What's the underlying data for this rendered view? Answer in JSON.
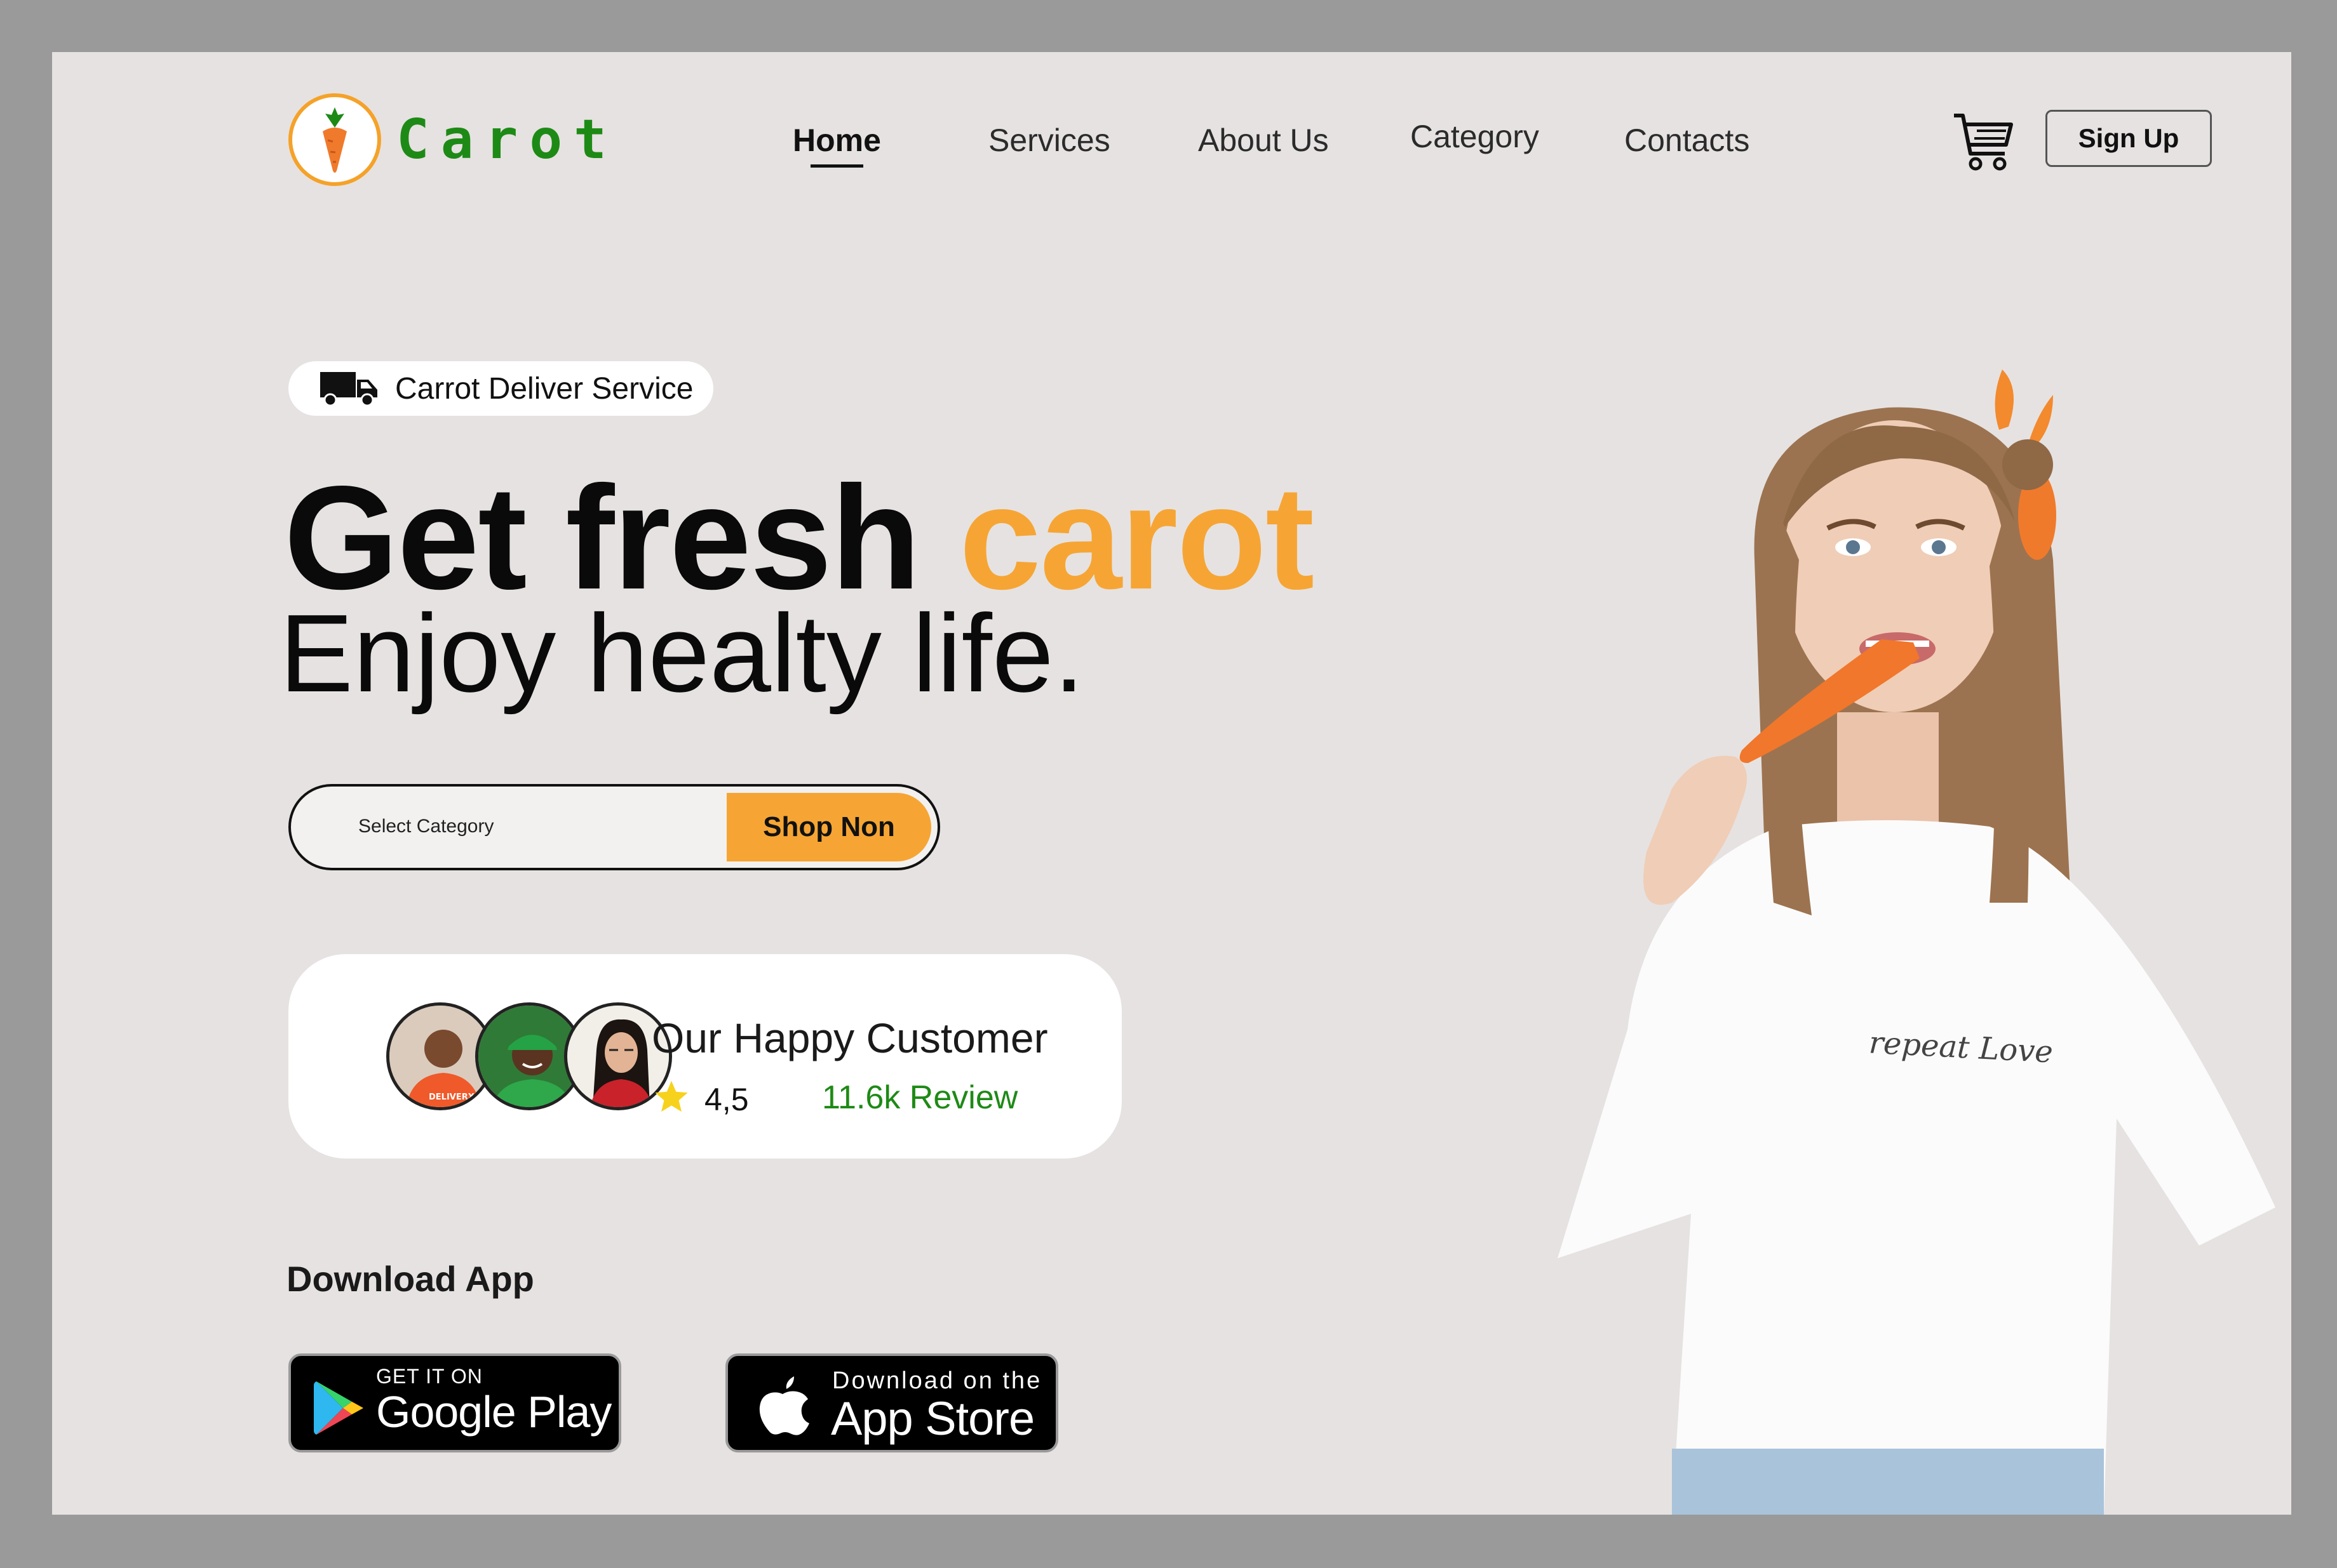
{
  "brand": {
    "name": "Carot",
    "icon": "carrot-icon",
    "color": "#1e8a16"
  },
  "nav": {
    "items": [
      {
        "label": "Home",
        "active": true
      },
      {
        "label": "Services",
        "active": false
      },
      {
        "label": "About Us",
        "active": false
      },
      {
        "label": "Category",
        "active": false
      },
      {
        "label": "Contacts",
        "active": false
      }
    ],
    "cart_icon": "cart-icon",
    "signup_label": "Sign Up"
  },
  "hero": {
    "badge": {
      "icon": "truck-icon",
      "label": "Carrot Deliver Service"
    },
    "headline_main": "Get fresh",
    "headline_accent": "carot",
    "subheadline": "Enjoy healty life.",
    "accent_color": "#f6a534"
  },
  "search": {
    "placeholder": "Select Category",
    "button_label": "Shop Non"
  },
  "customers": {
    "title": "Our Happy Customer",
    "rating": "4,5",
    "reviews": "11.6k Review",
    "star_icon": "star-icon",
    "avatar_badge": "DELIVERX"
  },
  "download": {
    "title": "Download App",
    "google_play": {
      "small": "GET IT ON",
      "big": "Google Play",
      "icon": "google-play-icon"
    },
    "app_store": {
      "small": "Download on the",
      "big": "App Store",
      "icon": "apple-icon"
    }
  },
  "image": {
    "shirt_text": "repeat Love"
  }
}
